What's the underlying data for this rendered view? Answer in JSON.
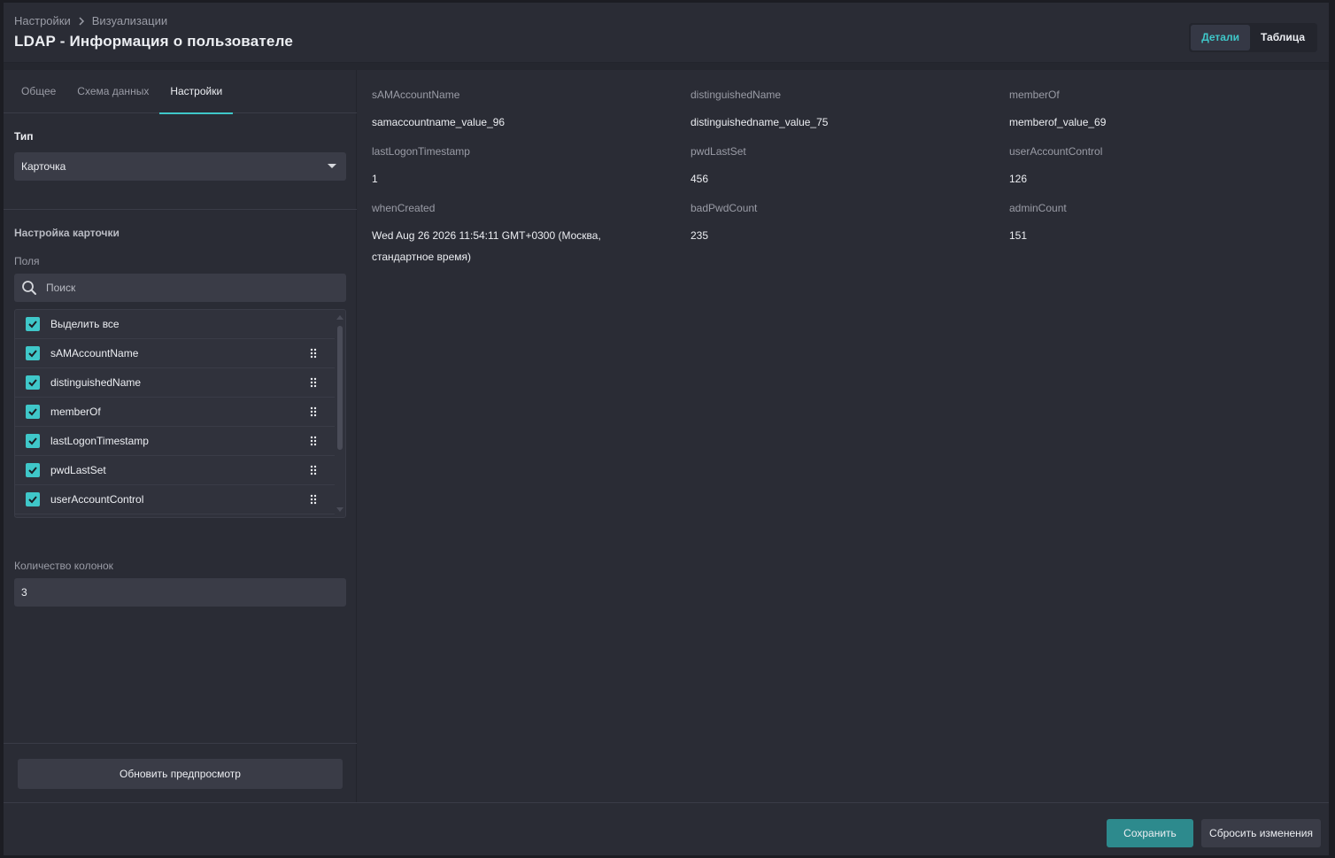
{
  "header": {
    "breadcrumb": [
      "Настройки",
      "Визуализации"
    ],
    "title": "LDAP - Информация о пользователе",
    "view_toggle": {
      "details": "Детали",
      "table": "Таблица",
      "active": "details"
    }
  },
  "left_panel": {
    "tabs": [
      "Общее",
      "Схема данных",
      "Настройки"
    ],
    "active_tab": 2,
    "type_label": "Тип",
    "type_value": "Карточка",
    "card_settings_label": "Настройка карточки",
    "fields_label": "Поля",
    "search_placeholder": "Поиск",
    "select_all_label": "Выделить все",
    "fields": [
      "sAMAccountName",
      "distinguishedName",
      "memberOf",
      "lastLogonTimestamp",
      "pwdLastSet",
      "userAccountControl"
    ],
    "columns_label": "Количество колонок",
    "columns_value": "3",
    "preview_button": "Обновить предпросмотр"
  },
  "preview": {
    "fields": [
      {
        "name": "sAMAccountName",
        "value": "samaccountname_value_96"
      },
      {
        "name": "distinguishedName",
        "value": "distinguishedname_value_75"
      },
      {
        "name": "memberOf",
        "value": "memberof_value_69"
      },
      {
        "name": "lastLogonTimestamp",
        "value": "1"
      },
      {
        "name": "pwdLastSet",
        "value": "456"
      },
      {
        "name": "userAccountControl",
        "value": "126"
      },
      {
        "name": "whenCreated",
        "value": "Wed Aug 26 2026 11:54:11 GMT+0300 (Москва, стандартное время)"
      },
      {
        "name": "badPwdCount",
        "value": "235"
      },
      {
        "name": "adminCount",
        "value": "151"
      }
    ]
  },
  "footer": {
    "save": "Сохранить",
    "reset": "Сбросить изменения"
  },
  "colors": {
    "accent": "#3fc7c9",
    "save_bg": "#2d8a8d",
    "panel": "#2a2c35"
  }
}
